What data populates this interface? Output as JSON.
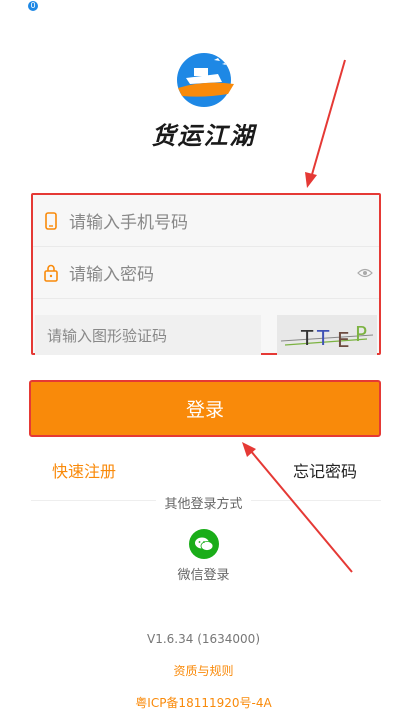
{
  "status": {
    "badge": "0"
  },
  "brand": {
    "name": "货运江湖"
  },
  "form": {
    "phone_placeholder": "请输入手机号码",
    "password_placeholder": "请输入密码",
    "captcha_placeholder": "请输入图形验证码",
    "captcha_chars": [
      "T",
      "T",
      "E",
      "P"
    ]
  },
  "actions": {
    "login_label": "登录",
    "register_label": "快速注册",
    "forgot_label": "忘记密码"
  },
  "other_login": {
    "label": "其他登录方式",
    "wechat_label": "微信登录"
  },
  "footer": {
    "version": "V1.6.34 (1634000)",
    "rules": "资质与规则",
    "icp": "粤ICP备18111920号-4A"
  },
  "colors": {
    "accent": "#f98a0a",
    "annotation": "#e53935",
    "wechat": "#1aad19"
  }
}
